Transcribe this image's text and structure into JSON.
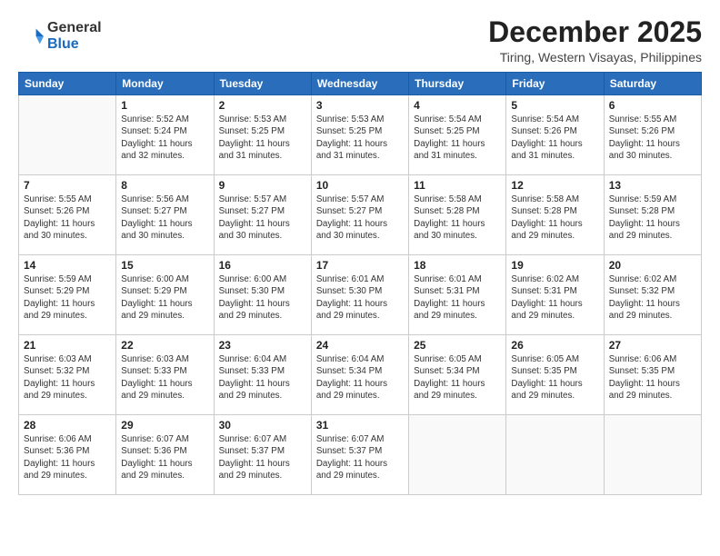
{
  "logo": {
    "general": "General",
    "blue": "Blue"
  },
  "header": {
    "month": "December 2025",
    "location": "Tiring, Western Visayas, Philippines"
  },
  "weekdays": [
    "Sunday",
    "Monday",
    "Tuesday",
    "Wednesday",
    "Thursday",
    "Friday",
    "Saturday"
  ],
  "weeks": [
    [
      {
        "day": "",
        "content": ""
      },
      {
        "day": "1",
        "content": "Sunrise: 5:52 AM\nSunset: 5:24 PM\nDaylight: 11 hours\nand 32 minutes."
      },
      {
        "day": "2",
        "content": "Sunrise: 5:53 AM\nSunset: 5:25 PM\nDaylight: 11 hours\nand 31 minutes."
      },
      {
        "day": "3",
        "content": "Sunrise: 5:53 AM\nSunset: 5:25 PM\nDaylight: 11 hours\nand 31 minutes."
      },
      {
        "day": "4",
        "content": "Sunrise: 5:54 AM\nSunset: 5:25 PM\nDaylight: 11 hours\nand 31 minutes."
      },
      {
        "day": "5",
        "content": "Sunrise: 5:54 AM\nSunset: 5:26 PM\nDaylight: 11 hours\nand 31 minutes."
      },
      {
        "day": "6",
        "content": "Sunrise: 5:55 AM\nSunset: 5:26 PM\nDaylight: 11 hours\nand 30 minutes."
      }
    ],
    [
      {
        "day": "7",
        "content": "Sunrise: 5:55 AM\nSunset: 5:26 PM\nDaylight: 11 hours\nand 30 minutes."
      },
      {
        "day": "8",
        "content": "Sunrise: 5:56 AM\nSunset: 5:27 PM\nDaylight: 11 hours\nand 30 minutes."
      },
      {
        "day": "9",
        "content": "Sunrise: 5:57 AM\nSunset: 5:27 PM\nDaylight: 11 hours\nand 30 minutes."
      },
      {
        "day": "10",
        "content": "Sunrise: 5:57 AM\nSunset: 5:27 PM\nDaylight: 11 hours\nand 30 minutes."
      },
      {
        "day": "11",
        "content": "Sunrise: 5:58 AM\nSunset: 5:28 PM\nDaylight: 11 hours\nand 30 minutes."
      },
      {
        "day": "12",
        "content": "Sunrise: 5:58 AM\nSunset: 5:28 PM\nDaylight: 11 hours\nand 29 minutes."
      },
      {
        "day": "13",
        "content": "Sunrise: 5:59 AM\nSunset: 5:28 PM\nDaylight: 11 hours\nand 29 minutes."
      }
    ],
    [
      {
        "day": "14",
        "content": "Sunrise: 5:59 AM\nSunset: 5:29 PM\nDaylight: 11 hours\nand 29 minutes."
      },
      {
        "day": "15",
        "content": "Sunrise: 6:00 AM\nSunset: 5:29 PM\nDaylight: 11 hours\nand 29 minutes."
      },
      {
        "day": "16",
        "content": "Sunrise: 6:00 AM\nSunset: 5:30 PM\nDaylight: 11 hours\nand 29 minutes."
      },
      {
        "day": "17",
        "content": "Sunrise: 6:01 AM\nSunset: 5:30 PM\nDaylight: 11 hours\nand 29 minutes."
      },
      {
        "day": "18",
        "content": "Sunrise: 6:01 AM\nSunset: 5:31 PM\nDaylight: 11 hours\nand 29 minutes."
      },
      {
        "day": "19",
        "content": "Sunrise: 6:02 AM\nSunset: 5:31 PM\nDaylight: 11 hours\nand 29 minutes."
      },
      {
        "day": "20",
        "content": "Sunrise: 6:02 AM\nSunset: 5:32 PM\nDaylight: 11 hours\nand 29 minutes."
      }
    ],
    [
      {
        "day": "21",
        "content": "Sunrise: 6:03 AM\nSunset: 5:32 PM\nDaylight: 11 hours\nand 29 minutes."
      },
      {
        "day": "22",
        "content": "Sunrise: 6:03 AM\nSunset: 5:33 PM\nDaylight: 11 hours\nand 29 minutes."
      },
      {
        "day": "23",
        "content": "Sunrise: 6:04 AM\nSunset: 5:33 PM\nDaylight: 11 hours\nand 29 minutes."
      },
      {
        "day": "24",
        "content": "Sunrise: 6:04 AM\nSunset: 5:34 PM\nDaylight: 11 hours\nand 29 minutes."
      },
      {
        "day": "25",
        "content": "Sunrise: 6:05 AM\nSunset: 5:34 PM\nDaylight: 11 hours\nand 29 minutes."
      },
      {
        "day": "26",
        "content": "Sunrise: 6:05 AM\nSunset: 5:35 PM\nDaylight: 11 hours\nand 29 minutes."
      },
      {
        "day": "27",
        "content": "Sunrise: 6:06 AM\nSunset: 5:35 PM\nDaylight: 11 hours\nand 29 minutes."
      }
    ],
    [
      {
        "day": "28",
        "content": "Sunrise: 6:06 AM\nSunset: 5:36 PM\nDaylight: 11 hours\nand 29 minutes."
      },
      {
        "day": "29",
        "content": "Sunrise: 6:07 AM\nSunset: 5:36 PM\nDaylight: 11 hours\nand 29 minutes."
      },
      {
        "day": "30",
        "content": "Sunrise: 6:07 AM\nSunset: 5:37 PM\nDaylight: 11 hours\nand 29 minutes."
      },
      {
        "day": "31",
        "content": "Sunrise: 6:07 AM\nSunset: 5:37 PM\nDaylight: 11 hours\nand 29 minutes."
      },
      {
        "day": "",
        "content": ""
      },
      {
        "day": "",
        "content": ""
      },
      {
        "day": "",
        "content": ""
      }
    ]
  ]
}
